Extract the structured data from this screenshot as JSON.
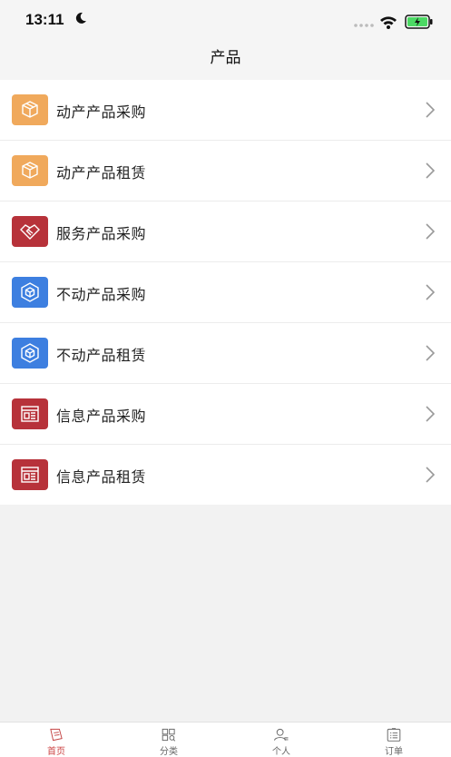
{
  "status": {
    "time": "13:11"
  },
  "nav": {
    "title": "产品"
  },
  "items": [
    {
      "label": "动产产品采购",
      "icon": "box-icon",
      "color": "#f0a95c"
    },
    {
      "label": "动产产品租赁",
      "icon": "box-icon",
      "color": "#f0a95c"
    },
    {
      "label": "服务产品采购",
      "icon": "handshake-icon",
      "color": "#b7323a"
    },
    {
      "label": "不动产品采购",
      "icon": "cube-icon",
      "color": "#3d7fe0"
    },
    {
      "label": "不动产品租赁",
      "icon": "cube-icon",
      "color": "#3d7fe0"
    },
    {
      "label": "信息产品采购",
      "icon": "document-icon",
      "color": "#b7323a"
    },
    {
      "label": "信息产品租赁",
      "icon": "document-icon",
      "color": "#b7323a"
    }
  ],
  "tabs": [
    {
      "label": "首页",
      "icon": "home-icon",
      "active": true
    },
    {
      "label": "分类",
      "icon": "category-icon",
      "active": false
    },
    {
      "label": "个人",
      "icon": "user-icon",
      "active": false
    },
    {
      "label": "订单",
      "icon": "clipboard-icon",
      "active": false
    }
  ],
  "colors": {
    "accent": "#c44444"
  }
}
